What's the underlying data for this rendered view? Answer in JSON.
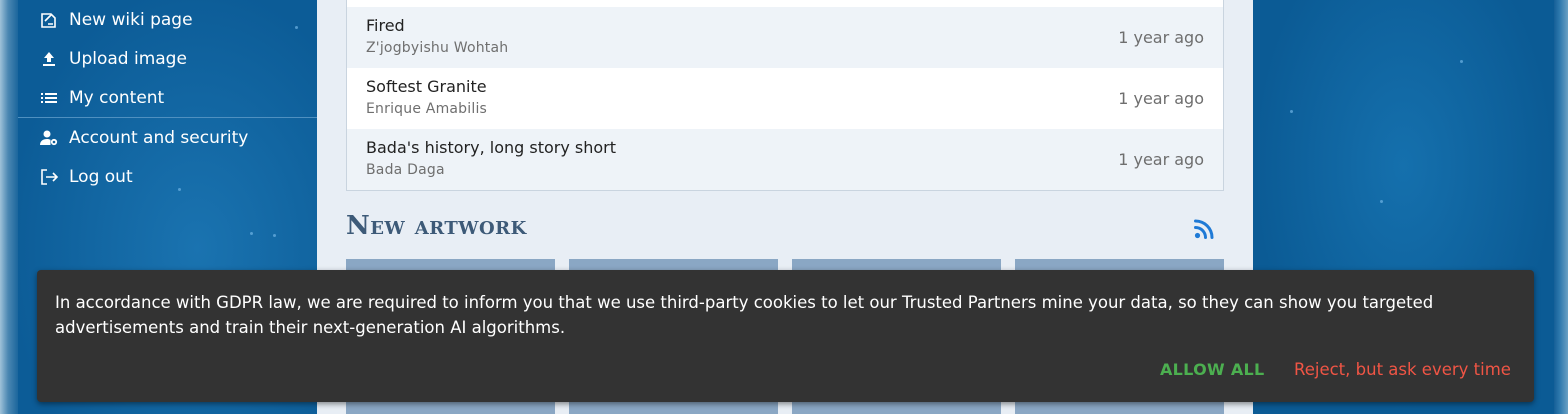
{
  "sidebar": {
    "items": [
      {
        "label": "New wiki page",
        "icon": "new-page-icon"
      },
      {
        "label": "Upload image",
        "icon": "upload-icon"
      },
      {
        "label": "My content",
        "icon": "list-icon"
      },
      {
        "label": "Account and security",
        "icon": "user-gear-icon"
      },
      {
        "label": "Log out",
        "icon": "logout-icon"
      }
    ]
  },
  "main": {
    "rows": [
      {
        "title": "Fired",
        "author": "Z'jogbyishu Wohtah",
        "time": "1 year ago"
      },
      {
        "title": "Softest Granite",
        "author": "Enrique Amabilis",
        "time": "1 year ago"
      },
      {
        "title": "Bada's history, long story short",
        "author": "Bada Daga",
        "time": "1 year ago"
      }
    ],
    "section_title": "New artwork",
    "rss_icon": "rss-icon",
    "accent": "#1f7ad6"
  },
  "cookie": {
    "message": "In accordance with GDPR law, we are required to inform you that we use third-party cookies to let our Trusted Partners mine your data, so they can show you targeted advertisements and train their next-generation AI algorithms.",
    "allow_label": "ALLOW ALL",
    "reject_label": "Reject, but ask every time",
    "allow_color": "#4caf50",
    "reject_color": "#f05545"
  }
}
